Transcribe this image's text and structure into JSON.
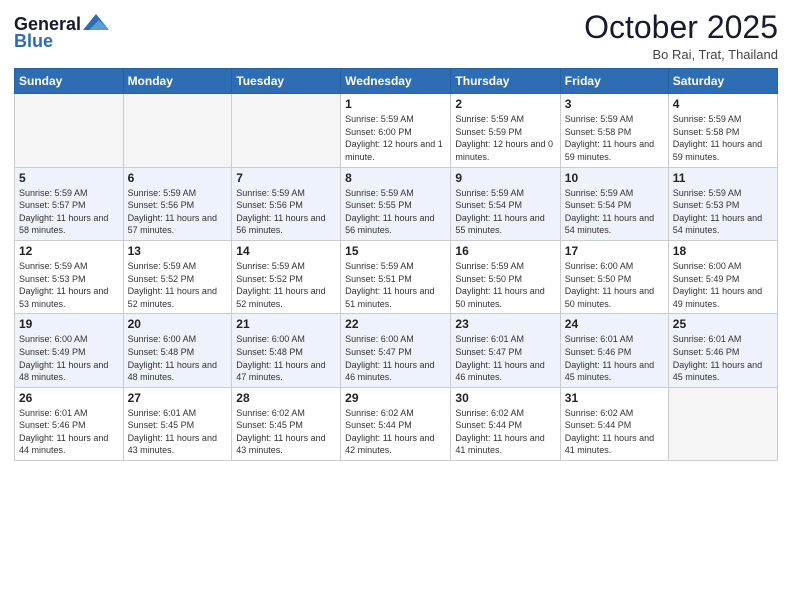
{
  "header": {
    "logo_general": "General",
    "logo_blue": "Blue",
    "month_title": "October 2025",
    "subtitle": "Bo Rai, Trat, Thailand"
  },
  "weekdays": [
    "Sunday",
    "Monday",
    "Tuesday",
    "Wednesday",
    "Thursday",
    "Friday",
    "Saturday"
  ],
  "weeks": [
    [
      {
        "day": "",
        "sunrise": "",
        "sunset": "",
        "daylight": "",
        "empty": true
      },
      {
        "day": "",
        "sunrise": "",
        "sunset": "",
        "daylight": "",
        "empty": true
      },
      {
        "day": "",
        "sunrise": "",
        "sunset": "",
        "daylight": "",
        "empty": true
      },
      {
        "day": "1",
        "sunrise": "Sunrise: 5:59 AM",
        "sunset": "Sunset: 6:00 PM",
        "daylight": "Daylight: 12 hours and 1 minute.",
        "empty": false
      },
      {
        "day": "2",
        "sunrise": "Sunrise: 5:59 AM",
        "sunset": "Sunset: 5:59 PM",
        "daylight": "Daylight: 12 hours and 0 minutes.",
        "empty": false
      },
      {
        "day": "3",
        "sunrise": "Sunrise: 5:59 AM",
        "sunset": "Sunset: 5:58 PM",
        "daylight": "Daylight: 11 hours and 59 minutes.",
        "empty": false
      },
      {
        "day": "4",
        "sunrise": "Sunrise: 5:59 AM",
        "sunset": "Sunset: 5:58 PM",
        "daylight": "Daylight: 11 hours and 59 minutes.",
        "empty": false
      }
    ],
    [
      {
        "day": "5",
        "sunrise": "Sunrise: 5:59 AM",
        "sunset": "Sunset: 5:57 PM",
        "daylight": "Daylight: 11 hours and 58 minutes.",
        "empty": false
      },
      {
        "day": "6",
        "sunrise": "Sunrise: 5:59 AM",
        "sunset": "Sunset: 5:56 PM",
        "daylight": "Daylight: 11 hours and 57 minutes.",
        "empty": false
      },
      {
        "day": "7",
        "sunrise": "Sunrise: 5:59 AM",
        "sunset": "Sunset: 5:56 PM",
        "daylight": "Daylight: 11 hours and 56 minutes.",
        "empty": false
      },
      {
        "day": "8",
        "sunrise": "Sunrise: 5:59 AM",
        "sunset": "Sunset: 5:55 PM",
        "daylight": "Daylight: 11 hours and 56 minutes.",
        "empty": false
      },
      {
        "day": "9",
        "sunrise": "Sunrise: 5:59 AM",
        "sunset": "Sunset: 5:54 PM",
        "daylight": "Daylight: 11 hours and 55 minutes.",
        "empty": false
      },
      {
        "day": "10",
        "sunrise": "Sunrise: 5:59 AM",
        "sunset": "Sunset: 5:54 PM",
        "daylight": "Daylight: 11 hours and 54 minutes.",
        "empty": false
      },
      {
        "day": "11",
        "sunrise": "Sunrise: 5:59 AM",
        "sunset": "Sunset: 5:53 PM",
        "daylight": "Daylight: 11 hours and 54 minutes.",
        "empty": false
      }
    ],
    [
      {
        "day": "12",
        "sunrise": "Sunrise: 5:59 AM",
        "sunset": "Sunset: 5:53 PM",
        "daylight": "Daylight: 11 hours and 53 minutes.",
        "empty": false
      },
      {
        "day": "13",
        "sunrise": "Sunrise: 5:59 AM",
        "sunset": "Sunset: 5:52 PM",
        "daylight": "Daylight: 11 hours and 52 minutes.",
        "empty": false
      },
      {
        "day": "14",
        "sunrise": "Sunrise: 5:59 AM",
        "sunset": "Sunset: 5:52 PM",
        "daylight": "Daylight: 11 hours and 52 minutes.",
        "empty": false
      },
      {
        "day": "15",
        "sunrise": "Sunrise: 5:59 AM",
        "sunset": "Sunset: 5:51 PM",
        "daylight": "Daylight: 11 hours and 51 minutes.",
        "empty": false
      },
      {
        "day": "16",
        "sunrise": "Sunrise: 5:59 AM",
        "sunset": "Sunset: 5:50 PM",
        "daylight": "Daylight: 11 hours and 50 minutes.",
        "empty": false
      },
      {
        "day": "17",
        "sunrise": "Sunrise: 6:00 AM",
        "sunset": "Sunset: 5:50 PM",
        "daylight": "Daylight: 11 hours and 50 minutes.",
        "empty": false
      },
      {
        "day": "18",
        "sunrise": "Sunrise: 6:00 AM",
        "sunset": "Sunset: 5:49 PM",
        "daylight": "Daylight: 11 hours and 49 minutes.",
        "empty": false
      }
    ],
    [
      {
        "day": "19",
        "sunrise": "Sunrise: 6:00 AM",
        "sunset": "Sunset: 5:49 PM",
        "daylight": "Daylight: 11 hours and 48 minutes.",
        "empty": false
      },
      {
        "day": "20",
        "sunrise": "Sunrise: 6:00 AM",
        "sunset": "Sunset: 5:48 PM",
        "daylight": "Daylight: 11 hours and 48 minutes.",
        "empty": false
      },
      {
        "day": "21",
        "sunrise": "Sunrise: 6:00 AM",
        "sunset": "Sunset: 5:48 PM",
        "daylight": "Daylight: 11 hours and 47 minutes.",
        "empty": false
      },
      {
        "day": "22",
        "sunrise": "Sunrise: 6:00 AM",
        "sunset": "Sunset: 5:47 PM",
        "daylight": "Daylight: 11 hours and 46 minutes.",
        "empty": false
      },
      {
        "day": "23",
        "sunrise": "Sunrise: 6:01 AM",
        "sunset": "Sunset: 5:47 PM",
        "daylight": "Daylight: 11 hours and 46 minutes.",
        "empty": false
      },
      {
        "day": "24",
        "sunrise": "Sunrise: 6:01 AM",
        "sunset": "Sunset: 5:46 PM",
        "daylight": "Daylight: 11 hours and 45 minutes.",
        "empty": false
      },
      {
        "day": "25",
        "sunrise": "Sunrise: 6:01 AM",
        "sunset": "Sunset: 5:46 PM",
        "daylight": "Daylight: 11 hours and 45 minutes.",
        "empty": false
      }
    ],
    [
      {
        "day": "26",
        "sunrise": "Sunrise: 6:01 AM",
        "sunset": "Sunset: 5:46 PM",
        "daylight": "Daylight: 11 hours and 44 minutes.",
        "empty": false
      },
      {
        "day": "27",
        "sunrise": "Sunrise: 6:01 AM",
        "sunset": "Sunset: 5:45 PM",
        "daylight": "Daylight: 11 hours and 43 minutes.",
        "empty": false
      },
      {
        "day": "28",
        "sunrise": "Sunrise: 6:02 AM",
        "sunset": "Sunset: 5:45 PM",
        "daylight": "Daylight: 11 hours and 43 minutes.",
        "empty": false
      },
      {
        "day": "29",
        "sunrise": "Sunrise: 6:02 AM",
        "sunset": "Sunset: 5:44 PM",
        "daylight": "Daylight: 11 hours and 42 minutes.",
        "empty": false
      },
      {
        "day": "30",
        "sunrise": "Sunrise: 6:02 AM",
        "sunset": "Sunset: 5:44 PM",
        "daylight": "Daylight: 11 hours and 41 minutes.",
        "empty": false
      },
      {
        "day": "31",
        "sunrise": "Sunrise: 6:02 AM",
        "sunset": "Sunset: 5:44 PM",
        "daylight": "Daylight: 11 hours and 41 minutes.",
        "empty": false
      },
      {
        "day": "",
        "sunrise": "",
        "sunset": "",
        "daylight": "",
        "empty": true
      }
    ]
  ]
}
